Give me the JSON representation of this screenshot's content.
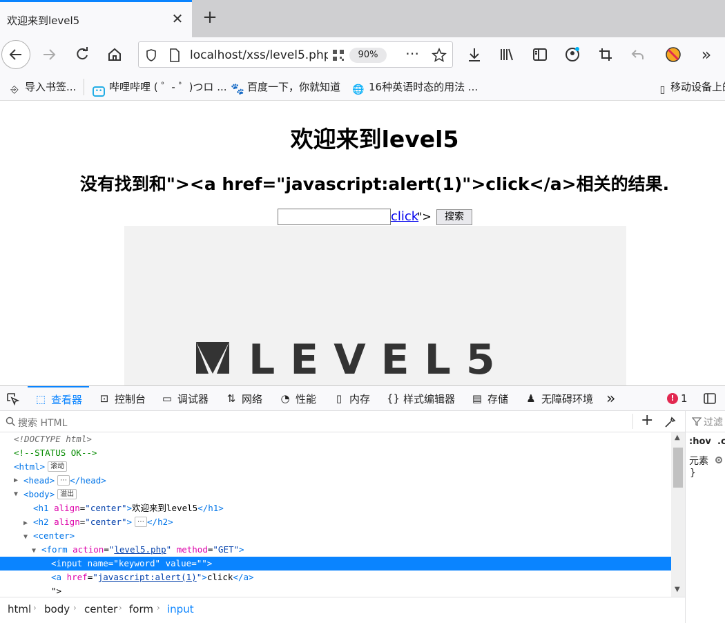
{
  "browser": {
    "tab_title": "欢迎来到level5",
    "tab_close": "✕",
    "new_tab": "+",
    "url": "localhost/xss/level5.php",
    "zoom": "90%"
  },
  "bookmarks": [
    {
      "label": "导入书签...",
      "icon": "import-icon"
    },
    {
      "label": "哔哩哔哩 ( ゜- ゜)つロ ...",
      "icon": "bilibili-icon"
    },
    {
      "label": "百度一下，你就知道",
      "icon": "baidu-icon"
    },
    {
      "label": "16种英语时态的用法 ...",
      "icon": "globe-icon"
    },
    {
      "label": "移动设备上的",
      "icon": "mobile-icon"
    }
  ],
  "page": {
    "heading": "欢迎来到level5",
    "subheading": "没有找到和\"><a href=\"javascript:alert(1)\">click</a>相关的结果.",
    "injected_link": "click",
    "leftover_text": "\">",
    "search_button": "搜索",
    "logo_text": "LEVEL5"
  },
  "devtools": {
    "tabs": {
      "inspector": "查看器",
      "console": "控制台",
      "debugger": "调试器",
      "network": "网络",
      "performance": "性能",
      "memory": "内存",
      "style_editor": "样式编辑器",
      "storage": "存储",
      "accessibility": "无障碍环境"
    },
    "error_count": "1",
    "search_placeholder": "搜索 HTML",
    "side": {
      "filter": "过滤",
      "hov": ":hov",
      "cls": ".c",
      "element": "元素",
      "brace": "}"
    },
    "markup": {
      "doctype": "<!DOCTYPE html>",
      "comment": "<!--STATUS OK-->",
      "badge_scroll": "滚动",
      "badge_overflow": "溢出",
      "h1_text": "欢迎来到level5",
      "h1_align": "center",
      "h2_align": "center",
      "form_action": "level5.php",
      "form_method": "GET",
      "input_name": "keyword",
      "input_value": "",
      "a_href": "javascript:alert(1)",
      "a_text": "click",
      "text_node": "\">"
    },
    "breadcrumb": [
      "html",
      "body",
      "center",
      "form",
      "input"
    ]
  }
}
